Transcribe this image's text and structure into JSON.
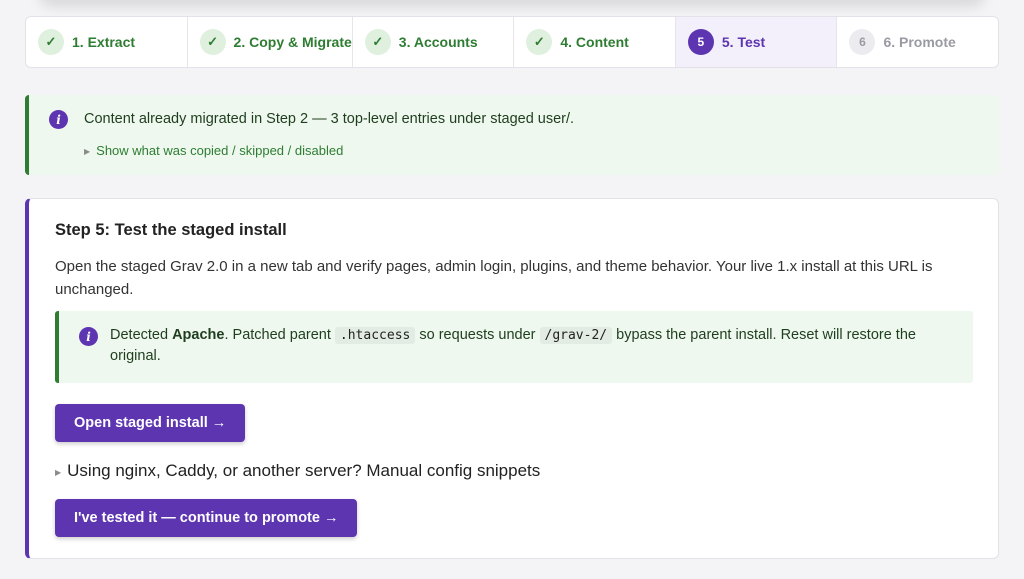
{
  "stepper": {
    "steps": [
      {
        "marker": "✓",
        "label": "1. Extract"
      },
      {
        "marker": "✓",
        "label": "2. Copy & Migrate"
      },
      {
        "marker": "✓",
        "label": "3. Accounts"
      },
      {
        "marker": "✓",
        "label": "4. Content"
      },
      {
        "marker": "5",
        "label": "5. Test"
      },
      {
        "marker": "6",
        "label": "6. Promote"
      }
    ]
  },
  "banner": {
    "icon": "i",
    "message": "Content already migrated in Step 2 — 3 top-level entries under staged user/.",
    "toggle_label": "Show what was copied / skipped / disabled"
  },
  "card": {
    "title": "Step 5: Test the staged install",
    "description": "Open the staged Grav 2.0 in a new tab and verify pages, admin login, plugins, and theme behavior. Your live 1.x install at this URL is unchanged.",
    "detect": {
      "icon": "i",
      "prefix": "Detected ",
      "server": "Apache",
      "mid1": ". Patched parent ",
      "file": ".htaccess",
      "mid2": " so requests under ",
      "path": "/grav-2/",
      "suffix": " bypass the parent install. Reset will restore the original."
    },
    "open_button": "Open staged install →",
    "manual_toggle": "Using nginx, Caddy, or another server? Manual config snippets",
    "continue_button": "I've tested it — continue to promote →"
  },
  "colors": {
    "accent": "#5e35b1",
    "success": "#2e7d32",
    "success_bg": "#eef8ee"
  }
}
